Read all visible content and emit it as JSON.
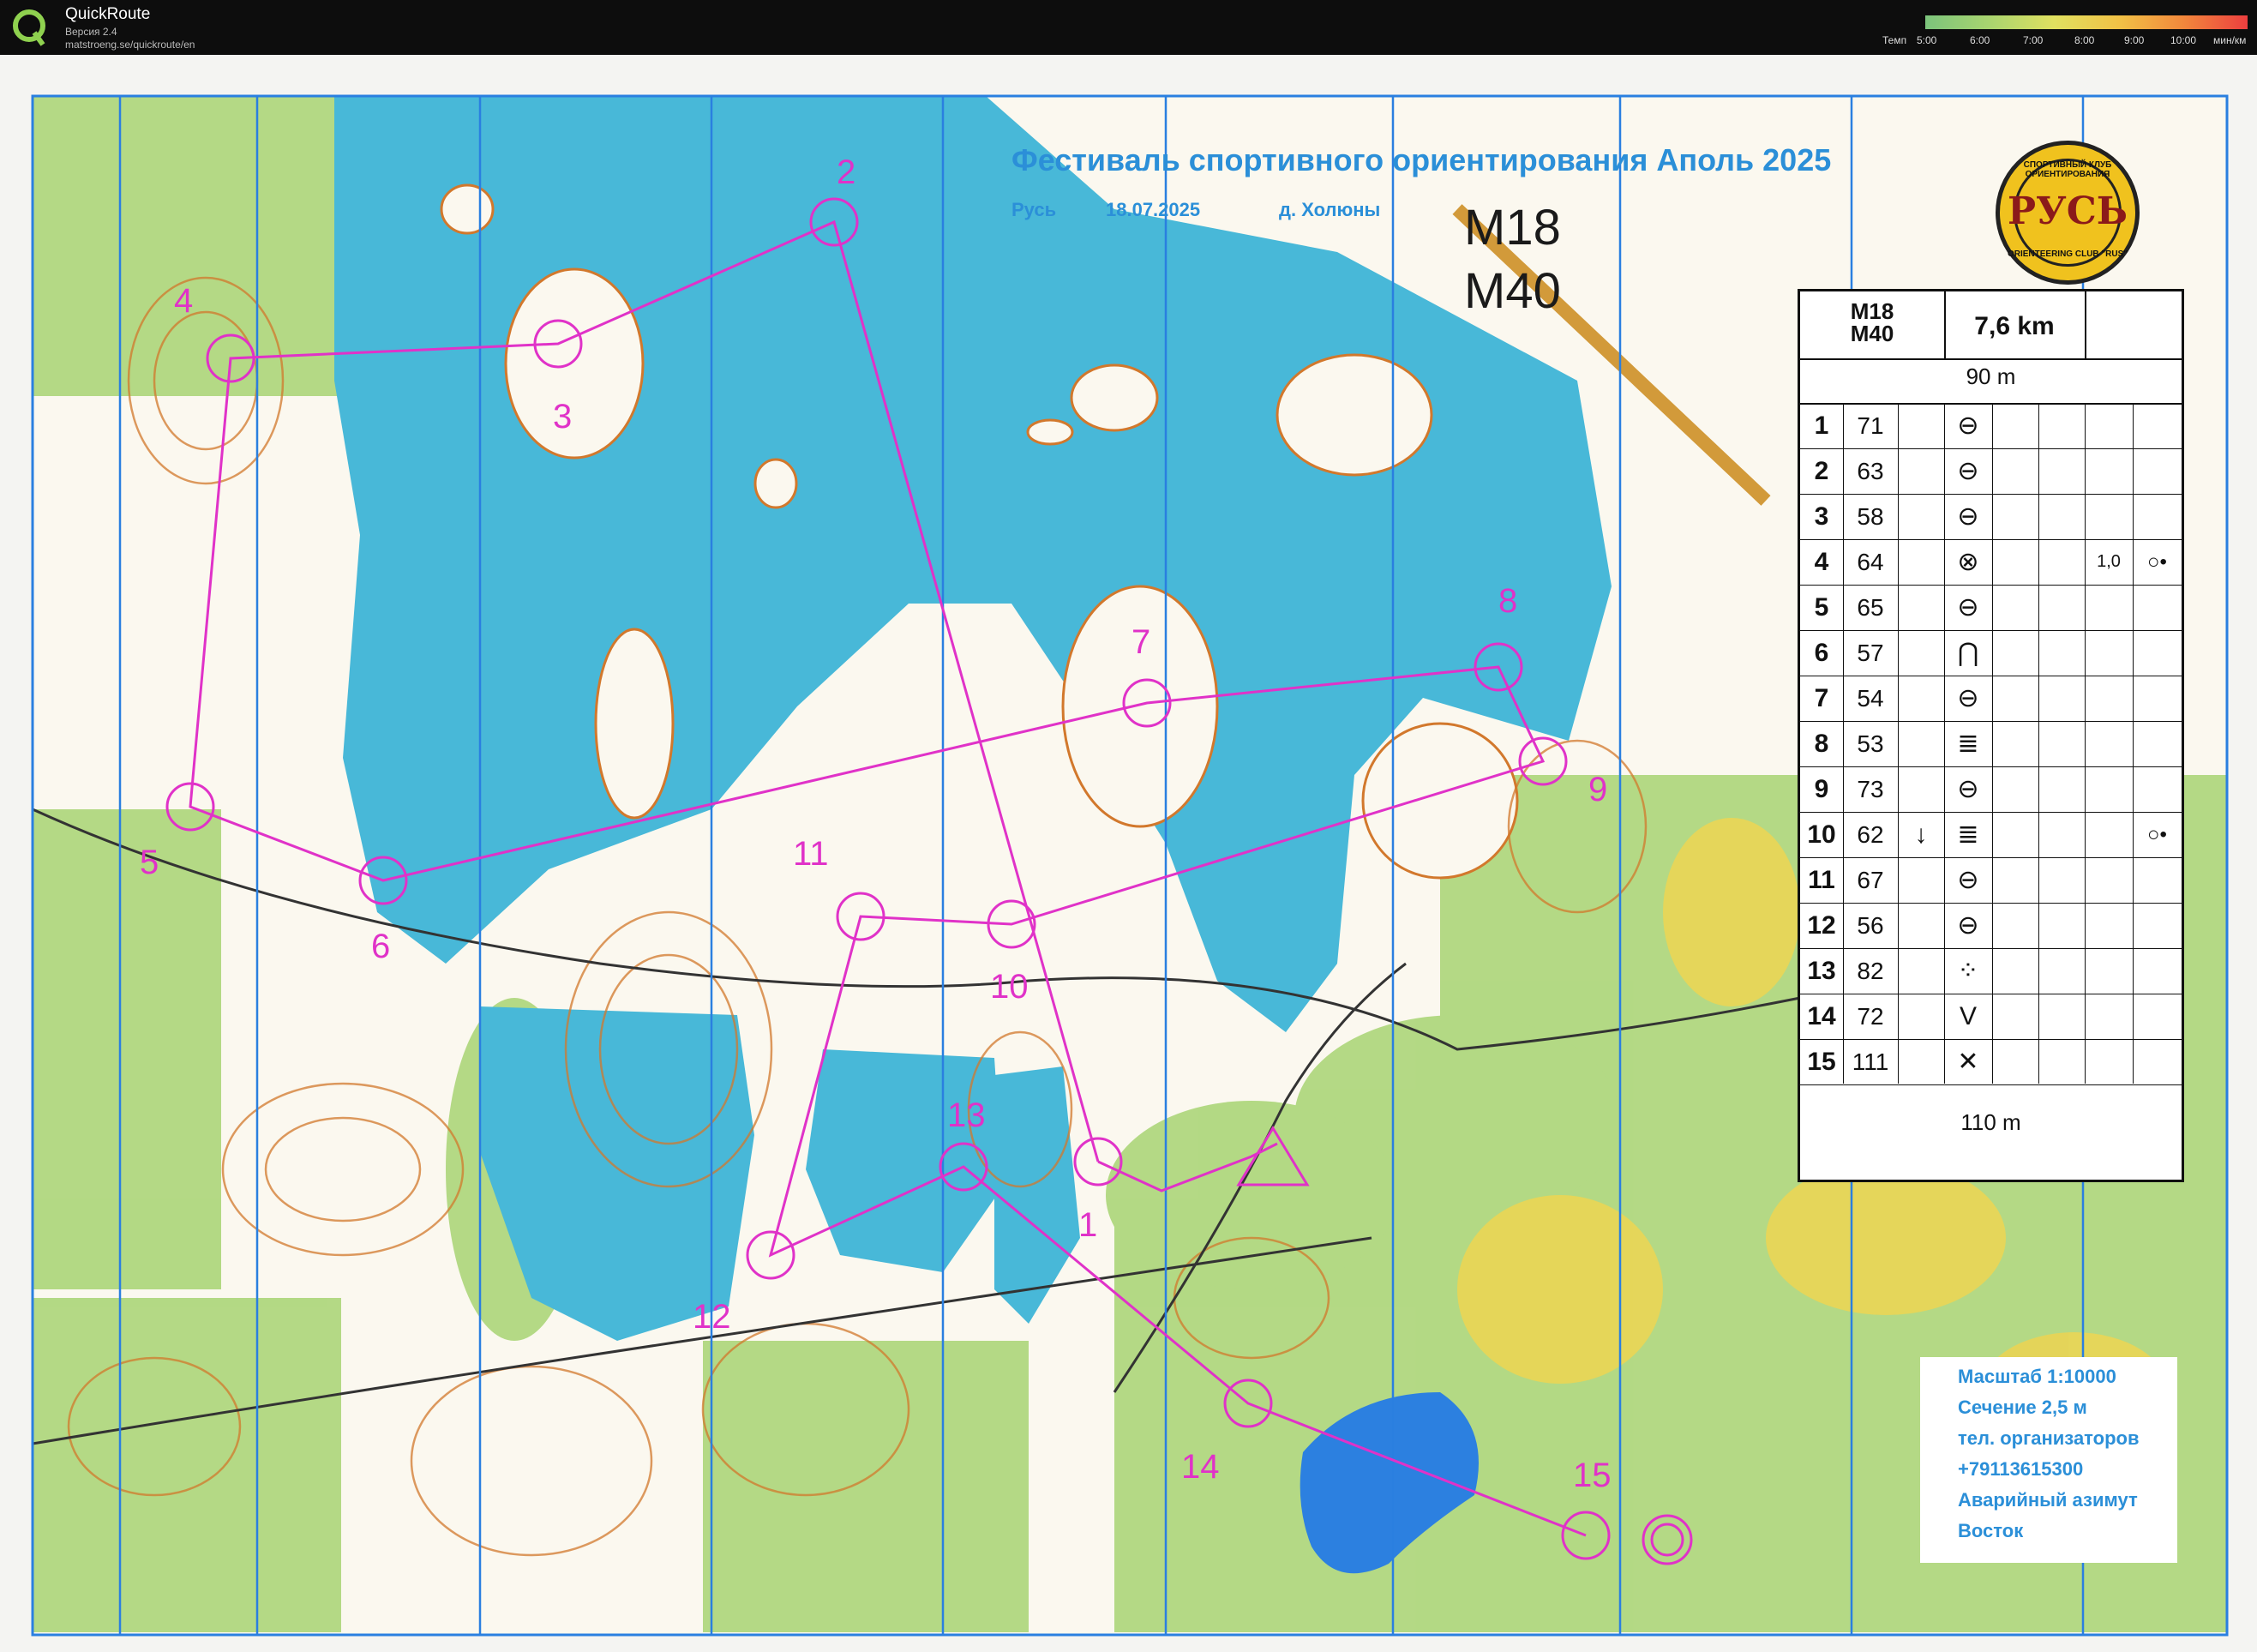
{
  "app": {
    "name": "QuickRoute",
    "version": "Версия 2.4",
    "url": "matstroeng.se/quickroute/en"
  },
  "pace_scale": {
    "label": "Темп",
    "ticks": [
      "5:00",
      "6:00",
      "7:00",
      "8:00",
      "9:00",
      "10:00"
    ],
    "unit": "мин/км"
  },
  "event": {
    "title": "Фестиваль спортивного ориентирования Аполь 2025",
    "place": "Русь",
    "date": "18.07.2025",
    "venue": "д. Холюны"
  },
  "classes": [
    "M18",
    "M40"
  ],
  "legend": {
    "lines": [
      "Масштаб 1:10000",
      "Сечение 2,5 м",
      "тел. организаторов",
      "+79113615300",
      "Аварийный азимут",
      "Восток"
    ]
  },
  "logo": {
    "top": "СПОРТИВНЫЙ КЛУБ ОРИЕНТИРОВАНИЯ",
    "main": "РУСЬ",
    "bottom": "ORIENTEERING CLUB \"RUS\""
  },
  "control_description": {
    "class_label": "M18\nM40",
    "length": "7,6 km",
    "start_distance": "90 m",
    "finish_distance": "110 m",
    "rows": [
      {
        "num": "1",
        "code": "71",
        "feature": "⊖",
        "dim": "",
        "extra": ""
      },
      {
        "num": "2",
        "code": "63",
        "feature": "⊖",
        "dim": "",
        "extra": ""
      },
      {
        "num": "3",
        "code": "58",
        "feature": "⊖",
        "dim": "",
        "extra": ""
      },
      {
        "num": "4",
        "code": "64",
        "feature": "⊗",
        "dim": "1,0",
        "extra": "○•"
      },
      {
        "num": "5",
        "code": "65",
        "feature": "⊖",
        "dim": "",
        "extra": ""
      },
      {
        "num": "6",
        "code": "57",
        "feature": "⋂",
        "dim": "",
        "extra": ""
      },
      {
        "num": "7",
        "code": "54",
        "feature": "⊖",
        "dim": "",
        "extra": ""
      },
      {
        "num": "8",
        "code": "53",
        "feature": "≣",
        "dim": "",
        "extra": ""
      },
      {
        "num": "9",
        "code": "73",
        "feature": "⊖",
        "dim": "",
        "extra": ""
      },
      {
        "num": "10",
        "code": "62",
        "feature": "≣",
        "dim": "",
        "extra": "○•",
        "which": "↓"
      },
      {
        "num": "11",
        "code": "67",
        "feature": "⊖",
        "dim": "",
        "extra": ""
      },
      {
        "num": "12",
        "code": "56",
        "feature": "⊖",
        "dim": "",
        "extra": ""
      },
      {
        "num": "13",
        "code": "82",
        "feature": "⁘",
        "dim": "",
        "extra": ""
      },
      {
        "num": "14",
        "code": "72",
        "feature": "V",
        "dim": "",
        "extra": ""
      },
      {
        "num": "15",
        "code": "111",
        "feature": "✕",
        "dim": "",
        "extra": ""
      }
    ]
  },
  "course_labels": [
    "1",
    "2",
    "3",
    "4",
    "5",
    "6",
    "7",
    "8",
    "9",
    "10",
    "11",
    "12",
    "13",
    "14",
    "15"
  ],
  "colors": {
    "course": "#e032c8",
    "water": "#43b6d8",
    "forest_green": "#9ccf6a",
    "contour": "#d2782c",
    "meridian": "#2a7fe0"
  }
}
